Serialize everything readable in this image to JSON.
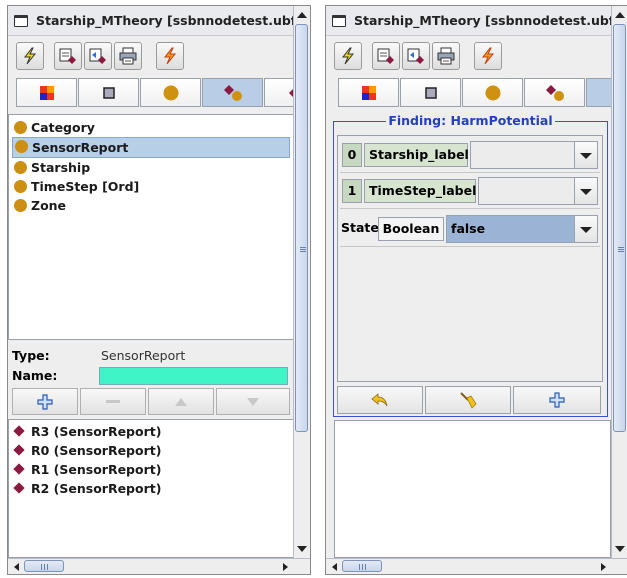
{
  "left_panel": {
    "title": "Starship_MTheory [ssbnnodetest.ubf]",
    "entities": [
      {
        "label": "Category"
      },
      {
        "label": "SensorReport",
        "selected": true
      },
      {
        "label": "Starship"
      },
      {
        "label": "TimeStep [Ord]"
      },
      {
        "label": "Zone"
      }
    ],
    "properties": {
      "type_label": "Type:",
      "type_value": "SensorReport",
      "name_label": "Name:",
      "name_value": ""
    },
    "instances": [
      {
        "label": "R3 (SensorReport)"
      },
      {
        "label": "R0 (SensorReport)"
      },
      {
        "label": "R1 (SensorReport)"
      },
      {
        "label": "R2 (SensorReport)"
      }
    ]
  },
  "right_panel": {
    "title": "Starship_MTheory [ssbnnodetest.ubf]",
    "finding": {
      "title": "Finding: HarmPotential",
      "arguments": [
        {
          "index": "0",
          "name": "Starship_label",
          "value": ""
        },
        {
          "index": "1",
          "name": "TimeStep_label",
          "value": ""
        }
      ],
      "state_label": "State:",
      "state_type": "Boolean",
      "state_value": "false"
    }
  },
  "colors": {
    "accent_blue": "#2340c0",
    "selection": "#b8cfe8",
    "entity_dot": "#cc8f14",
    "instance_diamond": "#8a1a42",
    "name_field": "#3ff5c8"
  },
  "icons": {
    "toolbar": [
      "lightning-icon",
      "edit-entity-icon",
      "edit-instance-icon",
      "printer-icon",
      "run-icon"
    ],
    "tabs": [
      "color-grid-icon",
      "square-icon",
      "circle-icon",
      "diamond-circle-icon",
      "diamond-icon"
    ],
    "edit_buttons": [
      "plus-icon",
      "minus-icon",
      "up-arrow-icon",
      "down-arrow-icon"
    ],
    "finding_buttons": [
      "undo-icon",
      "broom-icon",
      "plus-icon"
    ]
  }
}
